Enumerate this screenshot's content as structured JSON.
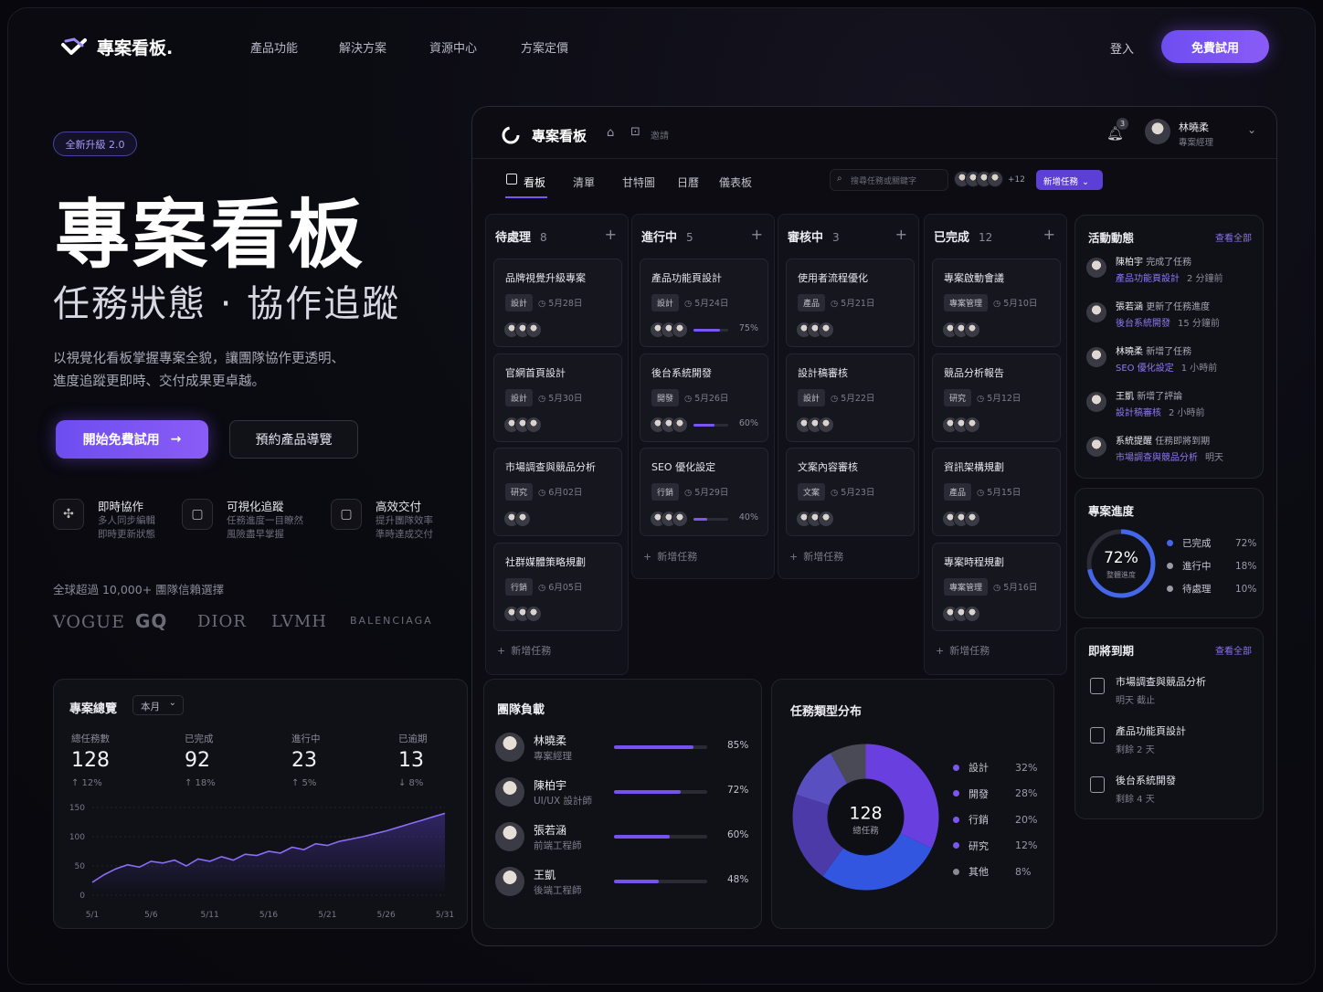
{
  "nav": {
    "brand": "專案看板.",
    "items": [
      "產品功能",
      "解決方案",
      "資源中心",
      "方案定價"
    ],
    "login": "登入",
    "trial": "免費試用"
  },
  "hero": {
    "badge": "全新升級 2.0",
    "title": "專案看板",
    "subtitle": "任務狀態 · 協作追蹤",
    "desc1": "以視覺化看板掌握專案全貌，讓團隊協作更透明、",
    "desc2": "進度追蹤更即時、交付成果更卓越。",
    "cta_primary": "開始免費試用",
    "cta_primary_icon": "→",
    "cta_secondary": "預約產品導覽"
  },
  "features": [
    {
      "icon": "collab-icon",
      "title": "即時協作",
      "d1": "多人同步編輯",
      "d2": "即時更新狀態"
    },
    {
      "icon": "doc-icon",
      "title": "可視化追蹤",
      "d1": "任務進度一目瞭然",
      "d2": "風險盡早掌握"
    },
    {
      "icon": "doc-icon",
      "title": "高效交付",
      "d1": "提升團隊效率",
      "d2": "準時達成交付"
    }
  ],
  "trust": {
    "text": "全球超過 10,000+ 團隊信賴選擇",
    "brands": [
      "VOGUE",
      "GQ",
      "DIOR",
      "LVMH",
      "BALENCIAGA"
    ]
  },
  "overview": {
    "title": "專案總覽",
    "period": "本月",
    "stats": [
      {
        "label": "總任務數",
        "value": "128",
        "change": "↑ 12%"
      },
      {
        "label": "已完成",
        "value": "92",
        "change": "↑ 18%"
      },
      {
        "label": "進行中",
        "value": "23",
        "change": "↑ 5%"
      },
      {
        "label": "已逾期",
        "value": "13",
        "change": "↓ 8%"
      }
    ]
  },
  "chart_data": [
    {
      "type": "area",
      "title": "專案總覽",
      "x": [
        "5/1",
        "5/2",
        "5/3",
        "5/4",
        "5/5",
        "5/6",
        "5/7",
        "5/8",
        "5/9",
        "5/10",
        "5/11",
        "5/12",
        "5/13",
        "5/14",
        "5/15",
        "5/16",
        "5/17",
        "5/18",
        "5/19",
        "5/20",
        "5/21",
        "5/22",
        "5/23",
        "5/24",
        "5/25",
        "5/26",
        "5/27",
        "5/28",
        "5/29",
        "5/30",
        "5/31"
      ],
      "xticks": [
        "5/1",
        "5/6",
        "5/11",
        "5/16",
        "5/21",
        "5/26",
        "5/31"
      ],
      "yticks": [
        "150",
        "100",
        "50",
        "0"
      ],
      "ylim": [
        0,
        150
      ],
      "values": [
        22,
        35,
        45,
        52,
        48,
        58,
        55,
        60,
        50,
        62,
        58,
        66,
        60,
        70,
        68,
        75,
        72,
        82,
        78,
        88,
        85,
        92,
        96,
        100,
        105,
        110,
        116,
        122,
        128,
        134,
        140
      ]
    },
    {
      "type": "pie",
      "title": "任務類型分布",
      "center_value": "128",
      "center_label": "總任務",
      "categories": [
        "設計",
        "開發",
        "行銷",
        "研究",
        "其他"
      ],
      "values": [
        32,
        28,
        20,
        12,
        8
      ],
      "labels": [
        "32%",
        "28%",
        "20%",
        "12%",
        "8%"
      ],
      "colors": [
        "#6a3fe0",
        "#3356e0",
        "#4c3aa8",
        "#5a4fc0",
        "#4a4a56"
      ]
    },
    {
      "type": "pie",
      "title": "專案進度",
      "center_value": "72%",
      "center_label": "整體進度",
      "categories": [
        "已完成",
        "進行中",
        "待處理"
      ],
      "values": [
        72,
        18,
        10
      ],
      "labels": [
        "72%",
        "18%",
        "10%"
      ]
    }
  ],
  "app": {
    "brand": "專案看板",
    "topicons": [
      "home-icon",
      "share-icon"
    ],
    "topbtn": "邀請",
    "notif": "3",
    "user": {
      "name": "林曉柔",
      "role": "專案經理"
    },
    "tabs": [
      "看板",
      "清單",
      "甘特圖",
      "日曆",
      "儀表板"
    ],
    "search_placeholder": "搜尋任務或關鍵字",
    "avatar_more": "+12",
    "new_task": "新增任務",
    "add_task": "新增任務",
    "columns": [
      {
        "name": "待處理",
        "count": "8",
        "cards": [
          {
            "title": "品牌視覺升級專案",
            "tag": "設計",
            "date": "5月28日"
          },
          {
            "title": "官網首頁設計",
            "tag": "設計",
            "date": "5月30日"
          },
          {
            "title": "市場調查與競品分析",
            "tag": "研究",
            "date": "6月02日"
          },
          {
            "title": "社群媒體策略規劃",
            "tag": "行銷",
            "date": "6月05日"
          }
        ]
      },
      {
        "name": "進行中",
        "count": "5",
        "cards": [
          {
            "title": "產品功能頁設計",
            "tag": "設計",
            "date": "5月24日",
            "pct": "75%",
            "p": 75
          },
          {
            "title": "後台系統開發",
            "tag": "開發",
            "date": "5月26日",
            "pct": "60%",
            "p": 60
          },
          {
            "title": "SEO 優化設定",
            "tag": "行銷",
            "date": "5月29日",
            "pct": "40%",
            "p": 40
          }
        ]
      },
      {
        "name": "審核中",
        "count": "3",
        "cards": [
          {
            "title": "使用者流程優化",
            "tag": "產品",
            "date": "5月21日"
          },
          {
            "title": "設計稿審核",
            "tag": "設計",
            "date": "5月22日"
          },
          {
            "title": "文案內容審核",
            "tag": "文案",
            "date": "5月23日"
          }
        ]
      },
      {
        "name": "已完成",
        "count": "12",
        "cards": [
          {
            "title": "專案啟動會議",
            "tag": "專案管理",
            "date": "5月10日"
          },
          {
            "title": "競品分析報告",
            "tag": "研究",
            "date": "5月12日"
          },
          {
            "title": "資訊架構規劃",
            "tag": "產品",
            "date": "5月15日"
          },
          {
            "title": "專案時程規劃",
            "tag": "專案管理",
            "date": "5月16日"
          }
        ]
      }
    ]
  },
  "activity": {
    "title": "活動動態",
    "link": "查看全部",
    "items": [
      {
        "who": "陳柏宇",
        "act": "完成了任務",
        "task": "產品功能頁設計",
        "time": "2 分鐘前"
      },
      {
        "who": "張若涵",
        "act": "更新了任務進度",
        "task": "後台系統開發",
        "time": "15 分鐘前"
      },
      {
        "who": "林曉柔",
        "act": "新增了任務",
        "task": "SEO 優化設定",
        "time": "1 小時前"
      },
      {
        "who": "王凱",
        "act": "新增了評論",
        "task": "設計稿審核",
        "time": "2 小時前"
      },
      {
        "who": "系統提醒",
        "act": "任務即將到期",
        "task": "市場調查與競品分析",
        "time": "明天"
      }
    ]
  },
  "progress": {
    "title": "專案進度",
    "value": "72%",
    "label": "整體進度",
    "legend": [
      {
        "name": "已完成",
        "pct": "72%",
        "color": "#4466e8"
      },
      {
        "name": "進行中",
        "pct": "18%",
        "color": "#9a9aa8"
      },
      {
        "name": "待處理",
        "pct": "10%",
        "color": "#9a9aa8"
      }
    ]
  },
  "upcoming": {
    "title": "即將到期",
    "link": "查看全部",
    "items": [
      {
        "name": "市場調查與競品分析",
        "due": "明天 截止"
      },
      {
        "name": "產品功能頁設計",
        "due": "剩餘 2 天"
      },
      {
        "name": "後台系統開發",
        "due": "剩餘 4 天"
      }
    ]
  },
  "workload": {
    "title": "團隊負載",
    "items": [
      {
        "name": "林曉柔",
        "role": "專案經理",
        "pct": "85%",
        "p": 85
      },
      {
        "name": "陳柏宇",
        "role": "UI/UX 設計師",
        "pct": "72%",
        "p": 72
      },
      {
        "name": "張若涵",
        "role": "前端工程師",
        "pct": "60%",
        "p": 60
      },
      {
        "name": "王凱",
        "role": "後端工程師",
        "pct": "48%",
        "p": 48
      }
    ]
  },
  "distribution": {
    "title": "任務類型分布"
  }
}
